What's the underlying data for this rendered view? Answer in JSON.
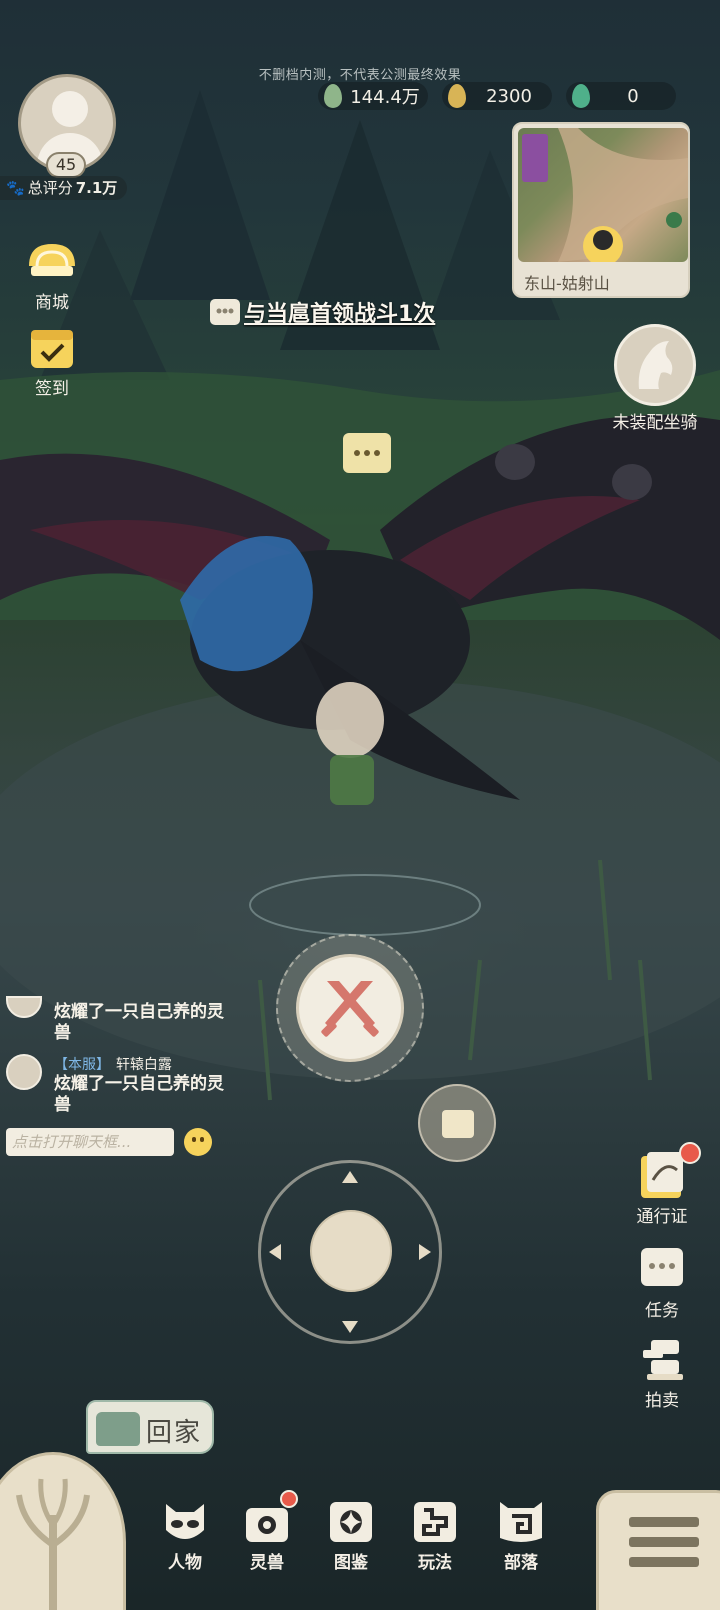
{
  "notice": "不删档内测，不代表公测最终效果",
  "currencies": [
    {
      "icon": "jade-leaf-icon",
      "value": "144.4万",
      "color": "#8fb58a"
    },
    {
      "icon": "gold-seed-icon",
      "value": "2300",
      "color": "#d8b456"
    },
    {
      "icon": "green-gem-icon",
      "value": "0",
      "color": "#4fb08a"
    }
  ],
  "player": {
    "level": "45",
    "score_label": "总评分",
    "score_value": "7.1万"
  },
  "left_menu": [
    {
      "label": "商城",
      "icon": "shop-icon"
    },
    {
      "label": "签到",
      "icon": "checkin-calendar-icon"
    }
  ],
  "quest": {
    "text": "与当扈首领战斗1次",
    "icon": "quest-bubble-icon"
  },
  "minimap": {
    "location": "东山-姑射山"
  },
  "mount": {
    "label": "未装配坐骑"
  },
  "chat": {
    "messages": [
      {
        "text": "炫耀了一只自己养的灵兽"
      },
      {
        "tag": "【本服】",
        "name": "轩辕白露",
        "text": "炫耀了一只自己养的灵兽"
      }
    ],
    "input_placeholder": "点击打开聊天框..."
  },
  "right_menu": [
    {
      "label": "通行证",
      "icon": "pass-icon"
    },
    {
      "label": "任务",
      "icon": "task-icon"
    },
    {
      "label": "拍卖",
      "icon": "auction-hammer-icon"
    }
  ],
  "home_button": "回家",
  "bottom_nav": [
    {
      "label": "人物",
      "icon": "character-mask-icon"
    },
    {
      "label": "灵兽",
      "icon": "spirit-beast-icon",
      "badge": true
    },
    {
      "label": "图鉴",
      "icon": "codex-icon"
    },
    {
      "label": "玩法",
      "icon": "gameplay-icon"
    },
    {
      "label": "部落",
      "icon": "tribe-icon"
    }
  ],
  "colors": {
    "accent": "#e8dfc9",
    "badge": "#e85a4a",
    "quest_text": "#fbf7ee"
  }
}
